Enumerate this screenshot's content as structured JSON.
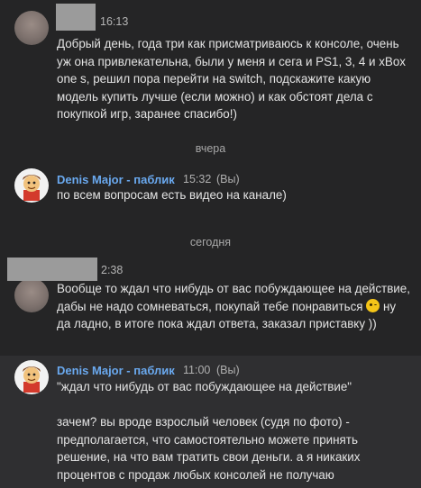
{
  "messages": [
    {
      "time": "16:13",
      "text": "Добрый день, года три как присматриваюсь к консоле, очень уж она привлекательна, были у меня и сега и PS1, 3, 4 и xBox one s, решил пора перейти на switch, подскажите какую модель купить лучше (если можно) и как обстоят дела с покупкой игр, заранее спасибо!)"
    },
    {
      "author": "Denis Major - паблик",
      "time": "15:32",
      "suffix": "(Вы)",
      "text": "по всем вопросам есть видео на канале)"
    },
    {
      "time": "2:38",
      "text_before": "Вообще то ждал что нибудь от вас побуждающее на действие, дабы не надо сомневаться, покупай тебе понравиться ",
      "text_after": " ну да ладно, в итоге пока ждал ответа, заказал приставку ))",
      "emoji": "smirk-emoji"
    },
    {
      "author": "Denis Major - паблик",
      "time": "11:00",
      "suffix": "(Вы)",
      "text": "\"ждал что нибудь от вас побуждающее на действие\"\n\nзачем? вы вроде взрослый человек (судя по фото) - предполагается, что самостоятельно можете принять решение, на что вам тратить свои деньги. а я никаких процентов с продаж любых консолей не получаю"
    }
  ],
  "separators": {
    "yesterday": "вчера",
    "today": "сегодня"
  }
}
